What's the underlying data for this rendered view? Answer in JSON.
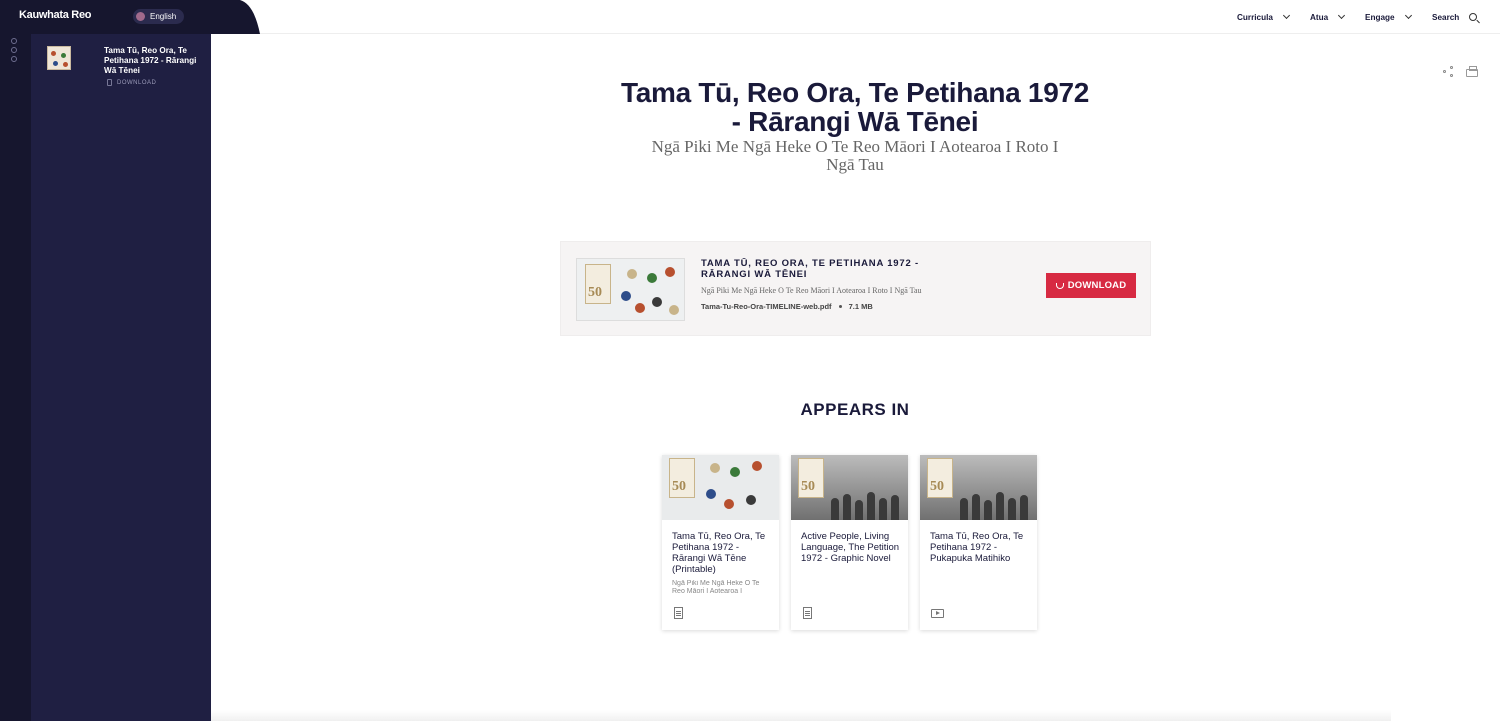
{
  "header": {
    "logo": "Kauwhata Reo",
    "language": "English",
    "nav": [
      {
        "label": "Curricula"
      },
      {
        "label": "Atua"
      },
      {
        "label": "Engage"
      }
    ],
    "search_label": "Search"
  },
  "sidebar": {
    "item_title": "Tama Tū, Reo Ora, Te Petihana 1972 - Rārangi Wā Tēnei",
    "download_label": "DOWNLOAD"
  },
  "page": {
    "title": "Tama Tū, Reo Ora, Te Petihana 1972 - Rārangi Wā Tēnei",
    "subtitle": "Ngā Piki Me Ngā Heke O Te Reo Māori I Aotearoa I Roto I Ngā Tau"
  },
  "download_card": {
    "title": "TAMA TŪ, REO ORA, TE PETIHANA 1972 - RĀRANGI WĀ TĒNEI",
    "description": "Ngā Piki Me Ngā Heke O Te Reo Māori I Aotearoa I Roto I Ngā Tau",
    "filename": "Tama-Tu-Reo-Ora-TIMELINE-web.pdf",
    "filesize": "7.1 MB",
    "button_label": "DOWNLOAD"
  },
  "appears_in": {
    "heading": "APPEARS IN",
    "cards": [
      {
        "title": "Tama Tū, Reo Ora, Te Petihana 1972 - Rārangi Wā Tēne (Printable)",
        "desc": "Ngā Piki Me Ngā Heke O Te Reo Māori I Aotearoa I",
        "icon": "document-icon"
      },
      {
        "title": "Active People, Living Language, The Petition 1972 - Graphic Novel",
        "desc": "",
        "icon": "document-icon"
      },
      {
        "title": "Tama Tū, Reo Ora, Te Petihana 1972 - Pukapuka Matihiko",
        "desc": "",
        "icon": "video-icon"
      }
    ]
  },
  "colors": {
    "dark_navy": "#16162e",
    "sidebar": "#1f1f42",
    "download_red": "#d72a42"
  }
}
